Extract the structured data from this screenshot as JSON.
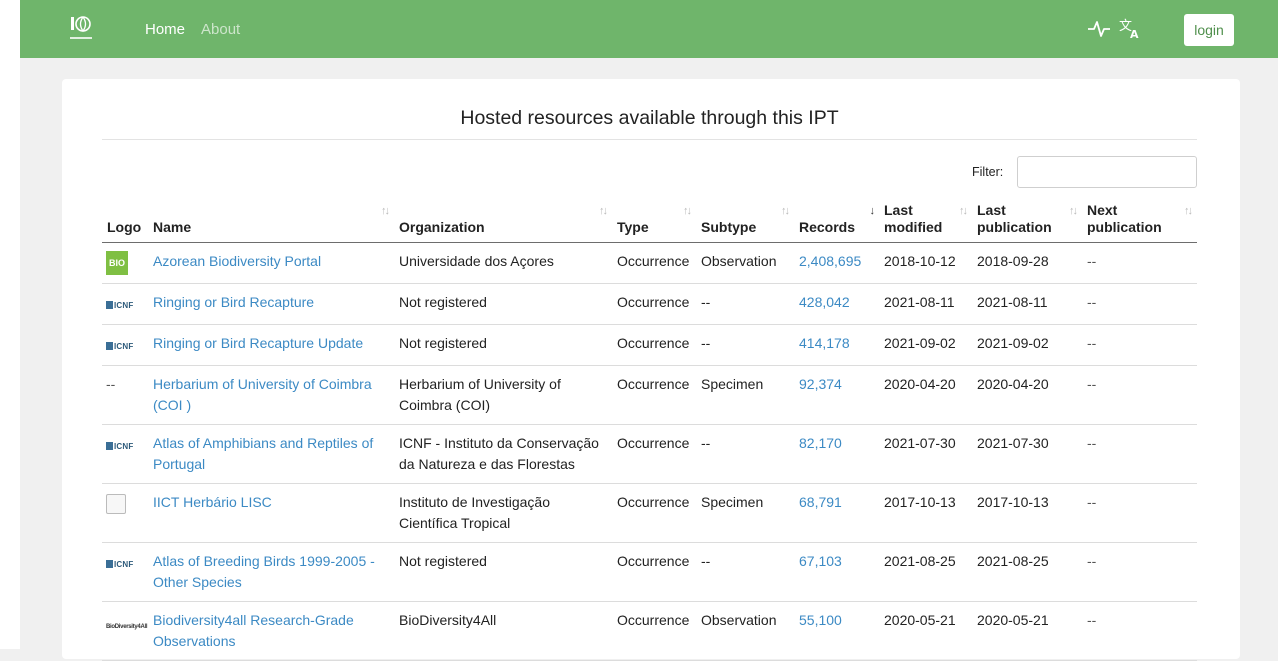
{
  "nav": {
    "logo_alt": "GBIF Portugal",
    "home_label": "Home",
    "about_label": "About",
    "health_icon": "activity-icon",
    "language_icon": "translate-icon",
    "login_label": "login",
    "brand_color": "#6fb56b"
  },
  "page": {
    "title": "Hosted resources available through this IPT",
    "filter_label": "Filter:",
    "filter_value": ""
  },
  "table": {
    "headers": {
      "logo": "Logo",
      "name": "Name",
      "organization": "Organization",
      "type": "Type",
      "subtype": "Subtype",
      "records": "Records",
      "last_modified_1": "Last",
      "last_modified_2": "modified",
      "last_publication_1": "Last",
      "last_publication_2": "publication",
      "next_publication_1": "Next",
      "next_publication_2": "publication"
    },
    "sort_icon": "↑↓",
    "sort_active_icon": "↓",
    "rows": [
      {
        "logo": "BIO",
        "logo_type": "bio",
        "name": "Azorean Biodiversity Portal",
        "organization": "Universidade dos Açores",
        "type": "Occurrence",
        "subtype": "Observation",
        "records": "2,408,695",
        "last_modified": "2018-10-12",
        "last_publication": "2018-09-28",
        "next_publication": "--"
      },
      {
        "logo": "ICNF",
        "logo_type": "icnf",
        "name": "Ringing or Bird Recapture",
        "organization": "Not registered",
        "type": "Occurrence",
        "subtype": "--",
        "records": "428,042",
        "last_modified": "2021-08-11",
        "last_publication": "2021-08-11",
        "next_publication": "--"
      },
      {
        "logo": "ICNF",
        "logo_type": "icnf",
        "name": "Ringing or Bird Recapture Update",
        "organization": "Not registered",
        "type": "Occurrence",
        "subtype": "--",
        "records": "414,178",
        "last_modified": "2021-09-02",
        "last_publication": "2021-09-02",
        "next_publication": "--"
      },
      {
        "logo": "--",
        "logo_type": "none",
        "name": "Herbarium of University of Coimbra (COI )",
        "organization": "Herbarium of University of Coimbra (COI)",
        "type": "Occurrence",
        "subtype": "Specimen",
        "records": "92,374",
        "last_modified": "2020-04-20",
        "last_publication": "2020-04-20",
        "next_publication": "--"
      },
      {
        "logo": "ICNF",
        "logo_type": "icnf",
        "name": "Atlas of Amphibians and Reptiles of Portugal",
        "organization": "ICNF - Instituto da Conservação da Natureza e das Florestas",
        "type": "Occurrence",
        "subtype": "--",
        "records": "82,170",
        "last_modified": "2021-07-30",
        "last_publication": "2021-07-30",
        "next_publication": "--"
      },
      {
        "logo": "",
        "logo_type": "doc",
        "name": "IICT Herbário LISC",
        "organization": "Instituto de Investigação Científica Tropical",
        "type": "Occurrence",
        "subtype": "Specimen",
        "records": "68,791",
        "last_modified": "2017-10-13",
        "last_publication": "2017-10-13",
        "next_publication": "--"
      },
      {
        "logo": "ICNF",
        "logo_type": "icnf",
        "name": "Atlas of Breeding Birds 1999-2005 - Other Species",
        "organization": "Not registered",
        "type": "Occurrence",
        "subtype": "--",
        "records": "67,103",
        "last_modified": "2021-08-25",
        "last_publication": "2021-08-25",
        "next_publication": "--"
      },
      {
        "logo": "BioDiversity4All",
        "logo_type": "b4a",
        "name": "Biodiversity4all Research-Grade Observations",
        "organization": "BioDiversity4All",
        "type": "Occurrence",
        "subtype": "Observation",
        "records": "55,100",
        "last_modified": "2020-05-21",
        "last_publication": "2020-05-21",
        "next_publication": "--"
      }
    ]
  }
}
